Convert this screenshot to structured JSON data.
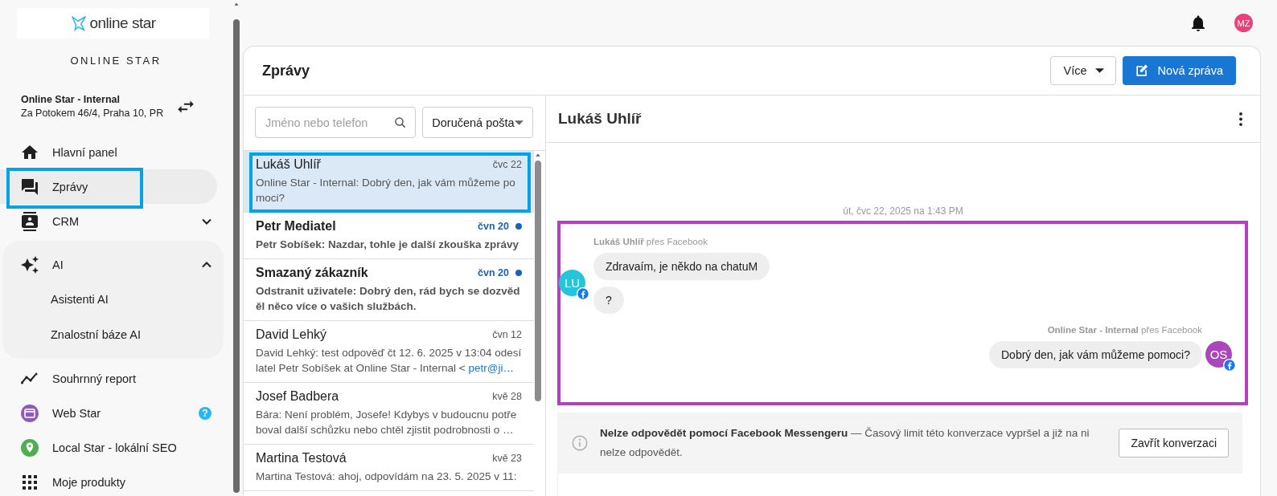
{
  "sidebar": {
    "logo": "online star",
    "brand": "ONLINE STAR",
    "account": {
      "name": "Online Star - Internal",
      "address": "Za Potokem 46/4, Praha 10, PR"
    },
    "items": [
      {
        "label": "Hlavní panel",
        "selected": false
      },
      {
        "label": "Zprávy",
        "selected": true,
        "highlighted": true
      },
      {
        "label": "CRM",
        "selected": false,
        "expanded": false
      },
      {
        "label": "AI",
        "selected": false,
        "expanded": true,
        "children": [
          {
            "label": "Asistenti AI",
            "selected": false
          },
          {
            "label": "Znalostní báze AI",
            "selected": false
          }
        ]
      },
      {
        "label": "Souhrnný report",
        "selected": false
      },
      {
        "label": "Web Star",
        "selected": false,
        "help": "?"
      },
      {
        "label": "Local Star - lokální SEO",
        "selected": false
      },
      {
        "label": "Moje produkty",
        "selected": false
      }
    ]
  },
  "topbar": {
    "avatar": "MZ"
  },
  "page": {
    "title": "Zprávy",
    "more_button": "Více",
    "new_button": "Nová zpráva"
  },
  "conversations": {
    "search": {
      "placeholder": "Jméno nebo telefon"
    },
    "folder": "Doručená pošta",
    "items": [
      {
        "name": "Lukáš Uhlíř",
        "date": "čvc 22",
        "preview": "Online Star - Internal: Dobrý den, jak vám můžeme pomoci?",
        "unread": false,
        "selected": true,
        "highlighted": true
      },
      {
        "name": "Petr Mediatel",
        "date": "čvn 20",
        "preview": "Petr Sobíšek: Nazdar, tohle je další zkouška zprávy",
        "unread": true,
        "selected": false
      },
      {
        "name": "Smazaný zákazník",
        "date": "čvn 20",
        "preview": "Odstranit uživatele: Dobrý den, rád bych se dozvěděl něco více o vašich službách.",
        "unread": true,
        "selected": false
      },
      {
        "name": "David Lehký",
        "date": "čvn 12",
        "preview": "David Lehký: test odpověď čt 12. 6. 2025 v 13:04 odesílatel Petr Sobíšek at Online Star - Internal < ",
        "preview_link": "petr@ji…",
        "unread": false,
        "selected": false
      },
      {
        "name": "Josef Badbera",
        "date": "kvě 28",
        "preview": "Bára: Není problém, Josefe! Kdybys v budoucnu potřeboval další schůzku nebo chtěl zjistit podrobnosti o …",
        "unread": false,
        "selected": false
      },
      {
        "name": "Martina Testová",
        "date": "kvě 23",
        "preview": "Martina Testová: ahoj, odpovídám na 23. 5. 2025 v 11:",
        "unread": false,
        "selected": false
      }
    ]
  },
  "chat": {
    "contact": "Lukáš Uhlíř",
    "timestamp": "út, čvc 22, 2025 na 1:43 PM",
    "highlighted": true,
    "groups": [
      {
        "outgoing": false,
        "sender": "**Lukáš Uhlíř** přes Facebook",
        "avatar": "LU",
        "color": "#26c6da",
        "bubbles": [
          "Zdravaím, je někdo na chatuM",
          "?"
        ]
      },
      {
        "outgoing": true,
        "sender": "**Online Star - Internal** přes Facebook",
        "avatar": "OS",
        "color": "#ab47bc",
        "bubbles": [
          "Dobrý den, jak vám můžeme pomoci?"
        ]
      }
    ],
    "notice": {
      "text": "**Nelze odpovědět pomocí Facebook Messengeru** — Časový limit této konverzace vypršel a již na ni nelze odpovědět.",
      "button": "Zavřít konverzaci"
    }
  }
}
